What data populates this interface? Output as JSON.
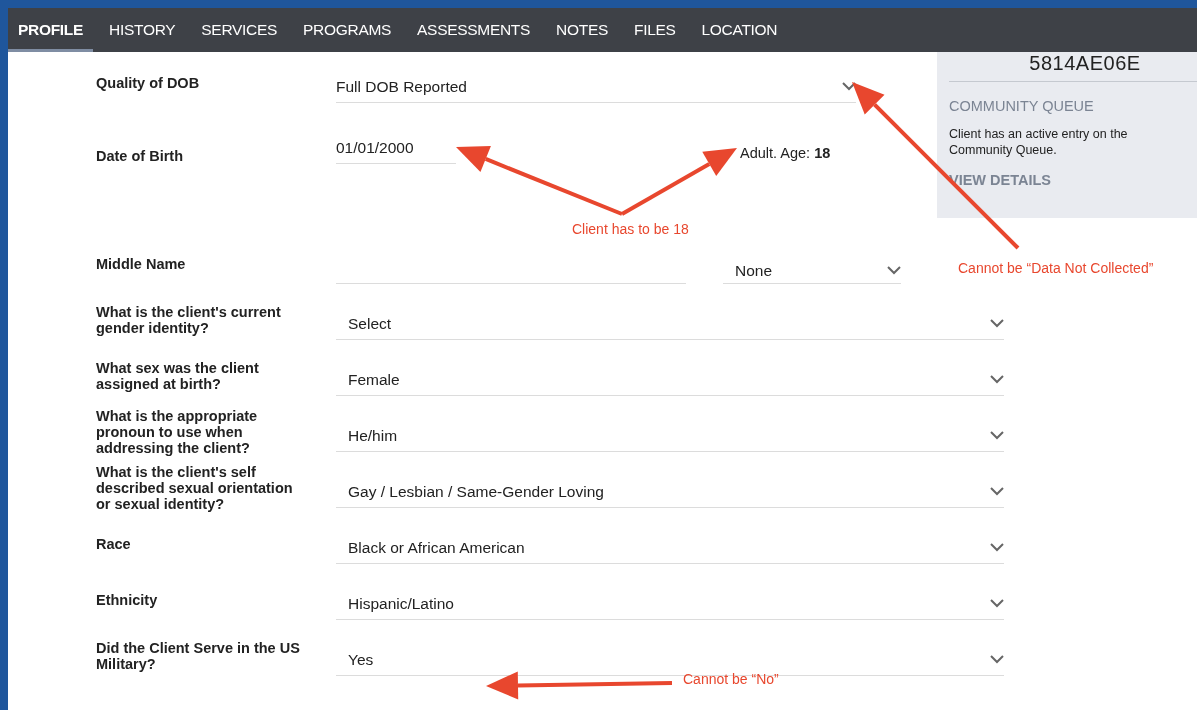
{
  "tabs": [
    {
      "label": "PROFILE",
      "selected": true
    },
    {
      "label": "HISTORY",
      "selected": false
    },
    {
      "label": "SERVICES",
      "selected": false
    },
    {
      "label": "PROGRAMS",
      "selected": false
    },
    {
      "label": "ASSESSMENTS",
      "selected": false
    },
    {
      "label": "NOTES",
      "selected": false
    },
    {
      "label": "FILES",
      "selected": false
    },
    {
      "label": "LOCATION",
      "selected": false
    }
  ],
  "top_fields": [
    {
      "kind": "select",
      "label": "Quality of DOB",
      "value": "Full DOB Reported"
    },
    {
      "kind": "date",
      "label": "Date of Birth",
      "value": "01/01/2000",
      "note": "Adult. Age: **18**"
    }
  ],
  "side_panel": {
    "client_id": "5814AE06E",
    "heading": "COMMUNITY QUEUE",
    "text": "Client has an active entry on the Community Queue.",
    "link": "VIEW DETAILS"
  },
  "fields": [
    {
      "kind": "text_suffix",
      "label": "Middle Name",
      "suffix": "None"
    },
    {
      "kind": "select",
      "label": "What is the client's current gender identity?",
      "value": "Select"
    },
    {
      "kind": "select",
      "label": "What sex was the client assigned at birth?",
      "value": "Female"
    },
    {
      "kind": "select",
      "label": "What is the appropriate pronoun to use when addressing the client?",
      "value": "He/him"
    },
    {
      "kind": "select",
      "label": "What is the client's self described sexual orientation or sexual identity?",
      "value": "Gay / Lesbian / Same-Gender Loving"
    },
    {
      "kind": "select",
      "label": "Race",
      "value": "Black or African American"
    },
    {
      "kind": "select",
      "label": "Ethnicity",
      "value": "Hispanic/Latino"
    },
    {
      "kind": "select",
      "label": "Did the Client Serve in the US Military?",
      "value": "Yes"
    }
  ],
  "annotations": [
    "Client has to be 18",
    "Cannot be “Data Not Collected”",
    "Cannot be “No”"
  ]
}
